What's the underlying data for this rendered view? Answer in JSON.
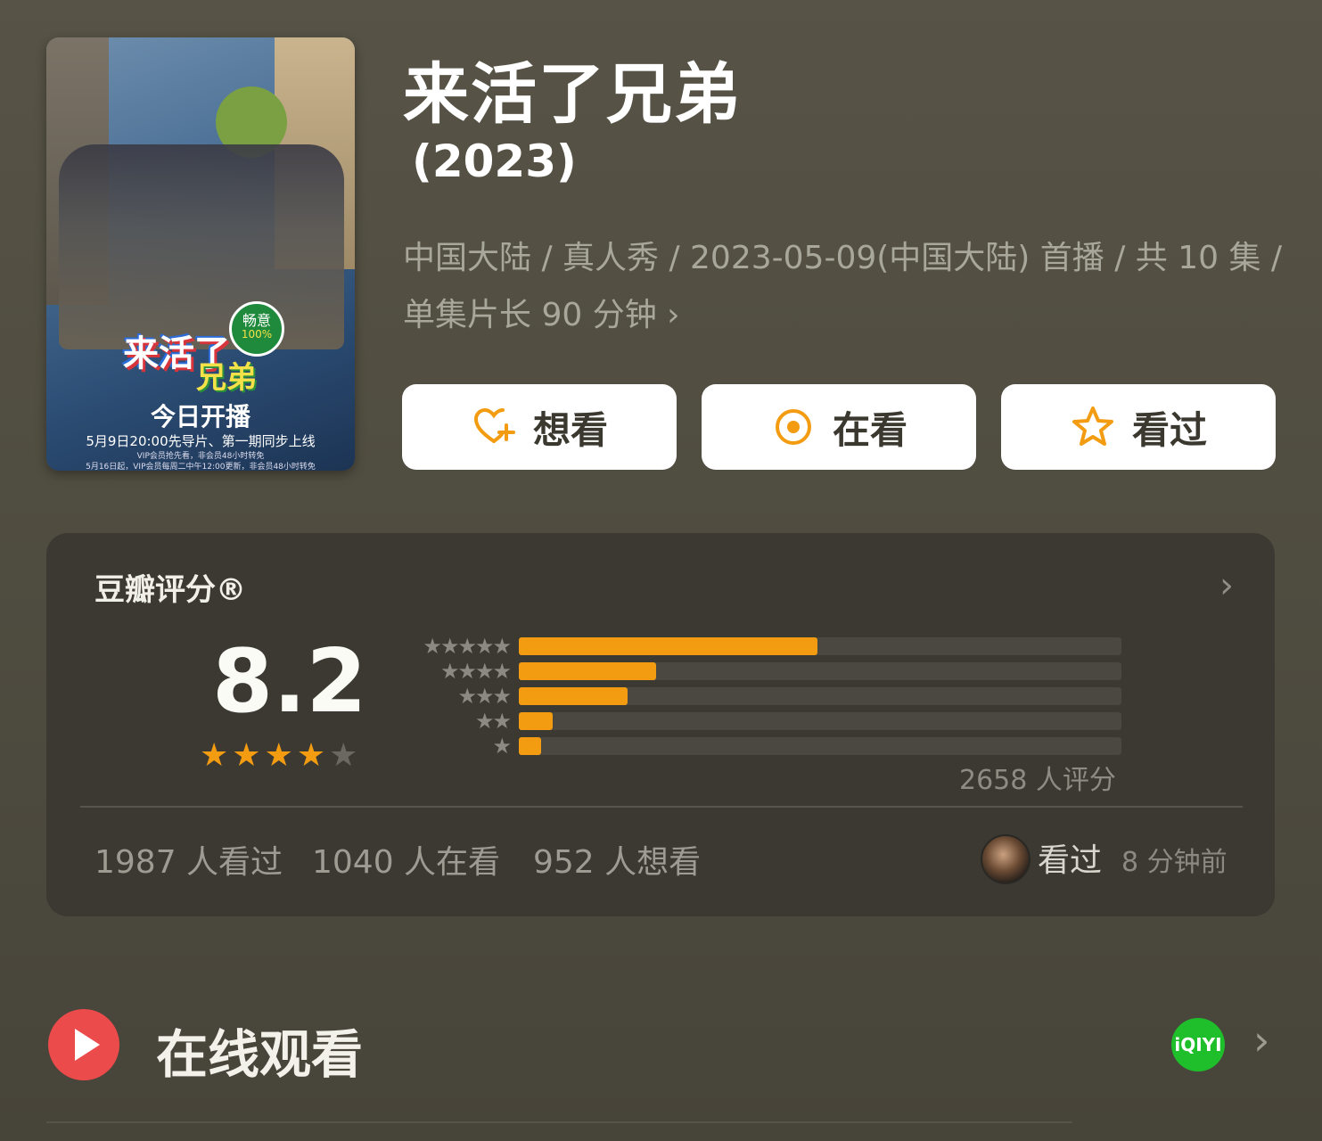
{
  "poster": {
    "badge_top": "畅意",
    "badge_bottom": "100%",
    "logo_a": "来活了",
    "logo_b": "兄弟",
    "headline": "今日开播",
    "sub": "5月9日20:00先导片、第一期同步上线",
    "fine1": "VIP会员抢先看，非会员48小时转免",
    "fine2": "5月16日起，VIP会员每周二中午12:00更新，非会员48小时转免"
  },
  "title": "来活了兄弟",
  "year": "(2023)",
  "meta_line": "中国大陆 / 真人秀 / 2023-05-09(中国大陆) 首播 / 共 10 集 / 单集片长 90 分钟",
  "meta_chevron": "›",
  "buttons": [
    {
      "label": "想看",
      "icon": "heart-plus-icon"
    },
    {
      "label": "在看",
      "icon": "target-circle-icon"
    },
    {
      "label": "看过",
      "icon": "star-outline-icon"
    }
  ],
  "rating": {
    "section_title": "豆瓣评分®",
    "chevron": "›",
    "score": "8.2",
    "stars": 4,
    "max_stars": 5,
    "distribution": [
      {
        "stars": 5,
        "label": "★★★★★",
        "fraction": 0.495
      },
      {
        "stars": 4,
        "label": "★★★★",
        "fraction": 0.228
      },
      {
        "stars": 3,
        "label": "★★★",
        "fraction": 0.18
      },
      {
        "stars": 2,
        "label": "★★",
        "fraction": 0.056
      },
      {
        "stars": 1,
        "label": "★",
        "fraction": 0.037
      }
    ],
    "rating_count": "2658 人评分",
    "stats": [
      {
        "text": "1987 人看过"
      },
      {
        "text": "1040 人在看"
      },
      {
        "text": "952 人想看"
      }
    ],
    "friend_action": "看过",
    "friend_time": "8 分钟前"
  },
  "online": {
    "label": "在线观看",
    "platform": "iQIYI",
    "chevron": "›"
  },
  "colors": {
    "accent_orange": "#f39c12",
    "play_red": "#ec4b4b",
    "iqiyi_green": "#1fbf2b"
  }
}
